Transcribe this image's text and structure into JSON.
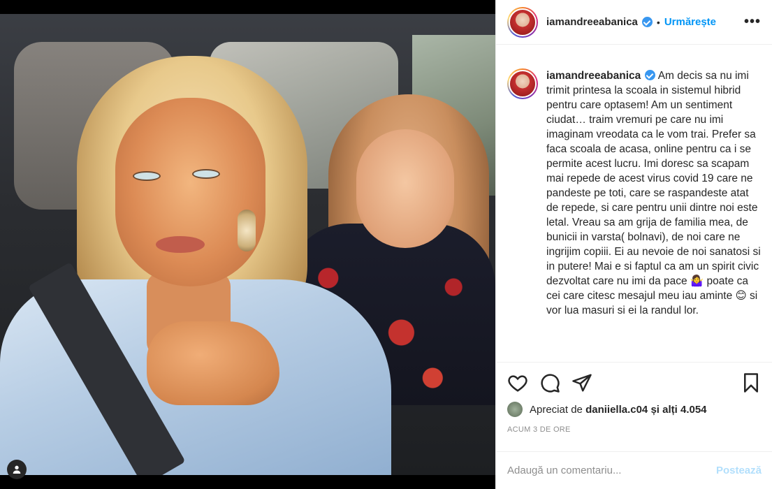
{
  "post": {
    "username": "iamandreeabanica",
    "follow_label": "Urmărește",
    "separator": "•",
    "more_label": "•••",
    "caption": "Am decis sa nu imi trimit printesa la scoala in sistemul hibrid pentru care optasem! Am un sentiment ciudat… traim vremuri pe care nu imi imaginam vreodata ca le vom trai. Prefer sa faca scoala de acasa, online pentru ca i se permite acest lucru. Imi doresc sa scapam mai repede de acest virus covid 19 care ne pandeste pe toti, care se raspandeste atat de repede, si care pentru unii dintre noi este letal. Vreau sa am grija de familia mea, de bunicii in varsta( bolnavi), de noi care ne ingrijim copiii. Ei au nevoie de noi sanatosi si in putere! Mai e si faptul ca am un spirit civic dezvoltat care nu imi da pace 🤷‍♀️ poate ca cei care citesc mesajul meu iau aminte 😊 si vor lua masuri si ei la randul lor.",
    "likes_prefix": "Apreciat de",
    "likes_user": "daniiella.c04",
    "likes_suffix": "și alți 4.054",
    "time": "ACUM 3 DE ORE",
    "comment_placeholder": "Adaugă un comentariu...",
    "post_label": "Postează"
  },
  "icons": {
    "like": "heart-icon",
    "comment": "comment-icon",
    "share": "share-icon",
    "save": "bookmark-icon",
    "tag": "user-tag-icon",
    "verified": "verified-badge-icon"
  },
  "colors": {
    "accent": "#0095f6",
    "verified": "#3897f0",
    "muted": "#8e8e8e",
    "post_disabled": "#b2dffc"
  }
}
